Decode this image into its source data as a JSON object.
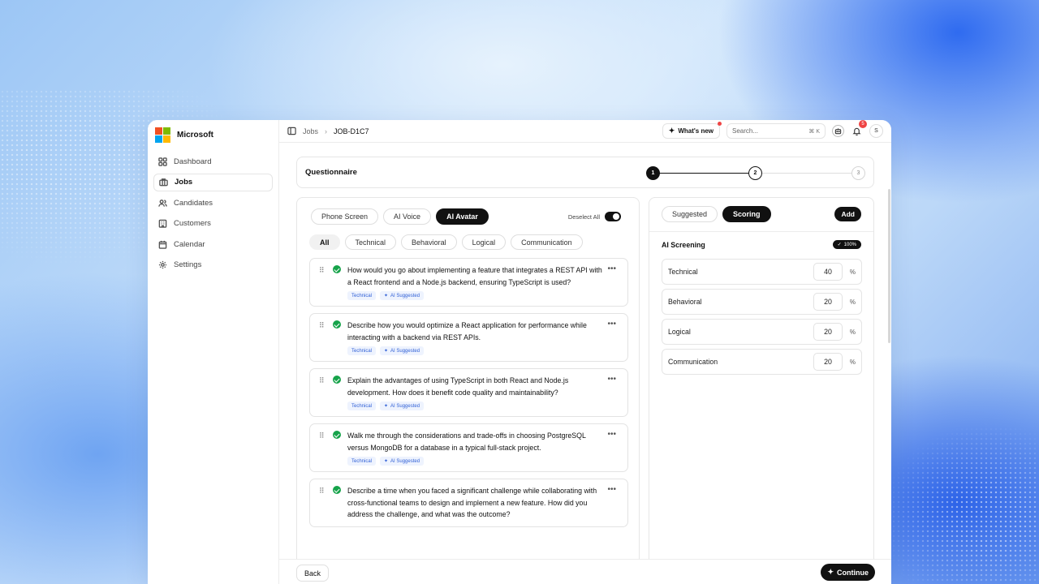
{
  "brand": {
    "name": "Microsoft"
  },
  "sidebar": {
    "items": [
      {
        "label": "Dashboard",
        "icon": "dashboard-icon"
      },
      {
        "label": "Jobs",
        "icon": "briefcase-icon",
        "active": true
      },
      {
        "label": "Candidates",
        "icon": "users-icon"
      },
      {
        "label": "Customers",
        "icon": "building-icon"
      },
      {
        "label": "Calendar",
        "icon": "calendar-icon"
      },
      {
        "label": "Settings",
        "icon": "gear-icon"
      }
    ]
  },
  "topbar": {
    "breadcrumb": [
      "Jobs",
      "JOB-D1C7"
    ],
    "whats_new": "What's new",
    "search_placeholder": "Search...",
    "search_shortcut": "⌘ K",
    "notification_count": "5",
    "avatar_initial": "S"
  },
  "stepper": {
    "title": "Questionnaire",
    "steps": [
      "1",
      "2",
      "3"
    ],
    "current": 2
  },
  "questions_panel": {
    "tabs": [
      "Phone Screen",
      "AI Voice",
      "AI Avatar"
    ],
    "active_tab": "AI Avatar",
    "deselect_label": "Deselect All",
    "filters": [
      "All",
      "Technical",
      "Behavioral",
      "Logical",
      "Communication"
    ],
    "active_filter": "All",
    "questions": [
      {
        "text": "How would you go about implementing a feature that integrates a REST API with a React frontend and a Node.js backend, ensuring TypeScript is used?",
        "category": "Technical",
        "source": "AI Suggested"
      },
      {
        "text": "Describe how you would optimize a React application for performance while interacting with a backend via REST APIs.",
        "category": "Technical",
        "source": "AI Suggested"
      },
      {
        "text": "Explain the advantages of using TypeScript in both React and Node.js development. How does it benefit code quality and maintainability?",
        "category": "Technical",
        "source": "AI Suggested"
      },
      {
        "text": "Walk me through the considerations and trade-offs in choosing PostgreSQL versus MongoDB for a database in a typical full-stack project.",
        "category": "Technical",
        "source": "AI Suggested"
      },
      {
        "text": "Describe a time when you faced a significant challenge while collaborating with cross-functional teams to design and implement a new feature. How did you address the challenge, and what was the outcome?",
        "category": "",
        "source": ""
      }
    ]
  },
  "scoring_panel": {
    "tabs": [
      "Suggested",
      "Scoring"
    ],
    "active_tab": "Scoring",
    "add_label": "Add",
    "section_title": "AI Screening",
    "total_label": "100%",
    "rows": [
      {
        "label": "Technical",
        "value": "40",
        "unit": "%"
      },
      {
        "label": "Behavioral",
        "value": "20",
        "unit": "%"
      },
      {
        "label": "Logical",
        "value": "20",
        "unit": "%"
      },
      {
        "label": "Communication",
        "value": "20",
        "unit": "%"
      }
    ]
  },
  "footer": {
    "back_label": "Back",
    "continue_label": "Continue"
  },
  "colors": {
    "accent": "#111111",
    "success": "#16a34a",
    "alert": "#ef4444",
    "tag_bg": "#eef3fe",
    "tag_text": "#2f5fd6"
  }
}
